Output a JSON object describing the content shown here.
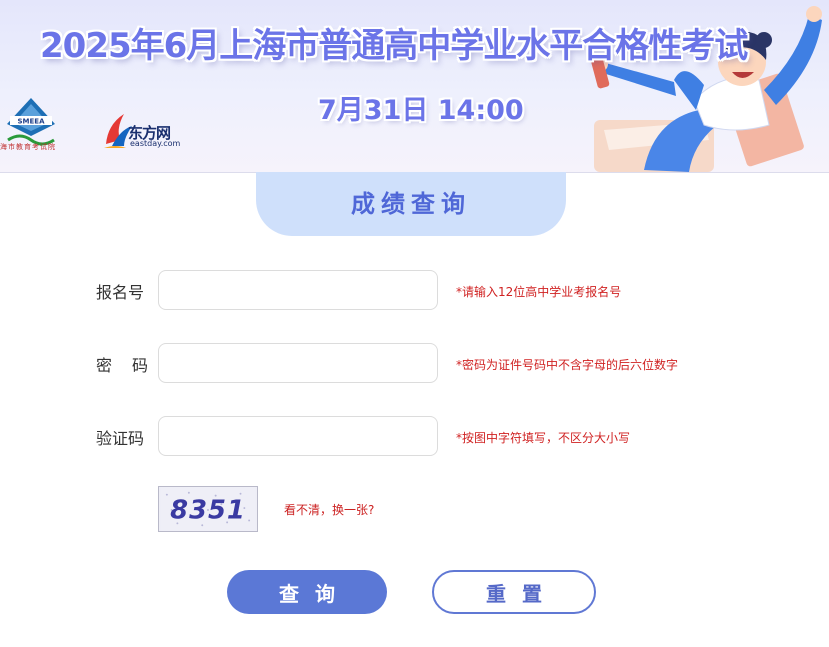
{
  "banner": {
    "title": "2025年6月上海市普通高中学业水平合格性考试",
    "date": "7月31日 14:00",
    "logos": [
      {
        "name": "SMEEA",
        "caption": "海市教育考试院",
        "icon": "smeea-logo-icon"
      },
      {
        "name": "东方网",
        "caption": "eastday.com",
        "icon": "eastday-logo-icon"
      }
    ]
  },
  "tab": {
    "title": "成绩查询"
  },
  "form": {
    "fields": [
      {
        "label": "报名号",
        "value": "",
        "placeholder": "",
        "hint": "*请输入12位高中学业考报名号"
      },
      {
        "label": "密码",
        "value": "",
        "placeholder": "",
        "hint": "*密码为证件号码中不含字母的后六位数字"
      },
      {
        "label": "验证码",
        "value": "",
        "placeholder": "",
        "hint": "*按图中字符填写，不区分大小写"
      }
    ],
    "captcha": {
      "text": "8351",
      "refresh_label": "看不清，换一张?"
    },
    "submit_label": "查询",
    "reset_label": "重置"
  },
  "colors": {
    "accent": "#5b78d6",
    "title_blue": "#6b74e8",
    "tab_bg": "#cfe0fb",
    "hint_red": "#d02222"
  }
}
